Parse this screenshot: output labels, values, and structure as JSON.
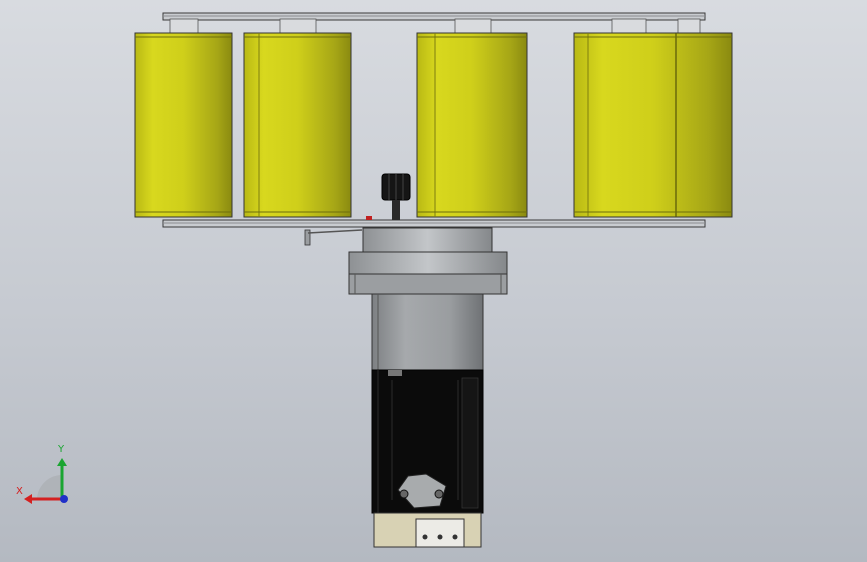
{
  "axis_triad": {
    "x_label": "X",
    "y_label": "Y",
    "x_color": "#d42020",
    "y_color": "#1aa531",
    "z_color": "#2030c8"
  },
  "colors": {
    "roller": "#cccc1a",
    "roller_dark": "#8f8f12",
    "motor": "#0a0a0a",
    "housing": "#9a9da0",
    "plate": "#c9ccd0",
    "base": "#d8d2b4"
  }
}
